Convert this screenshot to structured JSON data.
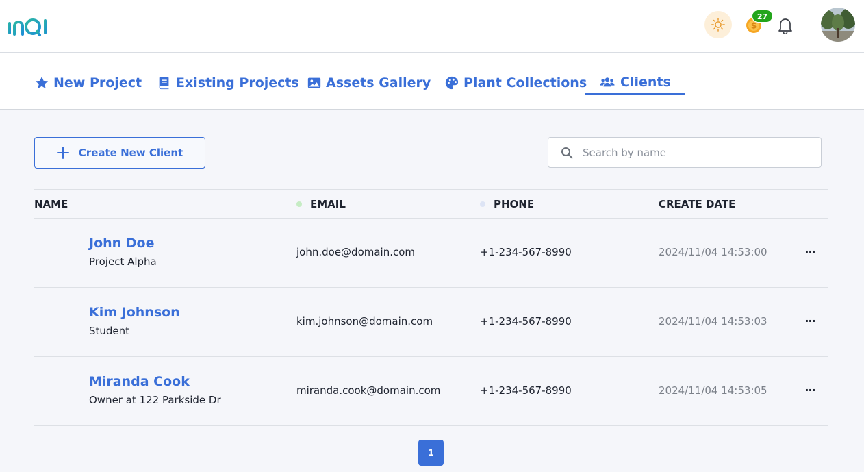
{
  "app": {
    "logo_text": "InQi",
    "coin_count": "27",
    "accent_color": "#3a6fd8"
  },
  "nav": {
    "tabs": [
      {
        "label": "New Project",
        "icon": "star-icon"
      },
      {
        "label": "Existing Projects",
        "icon": "book-icon"
      },
      {
        "label": "Assets Gallery",
        "icon": "image-icon"
      },
      {
        "label": "Plant Collections",
        "icon": "palette-icon"
      },
      {
        "label": "Clients",
        "icon": "users-icon",
        "active": true
      }
    ]
  },
  "toolbar": {
    "create_label": "Create New Client",
    "search_placeholder": "Search by name"
  },
  "table": {
    "headers": {
      "name": "NAME",
      "email": "EMAIL",
      "phone": "PHONE",
      "create_date": "CREATE DATE"
    },
    "rows": [
      {
        "name": "John Doe",
        "subtitle": "Project Alpha",
        "email": "john.doe@domain.com",
        "phone": "+1-234-567-8990",
        "date": "2024/11/04 14:53:00",
        "more": "···"
      },
      {
        "name": "Kim Johnson",
        "subtitle": "Student",
        "email": "kim.johnson@domain.com",
        "phone": "+1-234-567-8990",
        "date": "2024/11/04 14:53:03",
        "more": "···"
      },
      {
        "name": "Miranda Cook",
        "subtitle": "Owner at 122 Parkside Dr",
        "email": "miranda.cook@domain.com",
        "phone": "+1-234-567-8990",
        "date": "2024/11/04 14:53:05",
        "more": "···"
      }
    ]
  },
  "pagination": {
    "current_page": "1"
  }
}
